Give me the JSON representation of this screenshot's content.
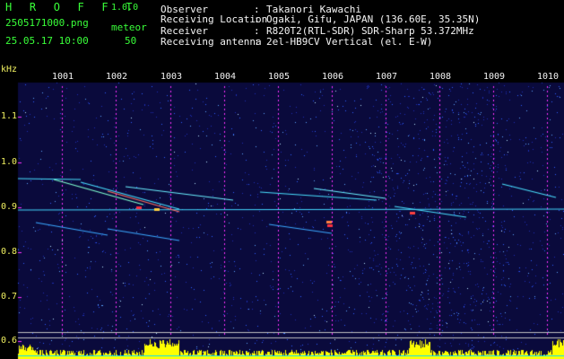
{
  "header": {
    "logo": "H R O F F T",
    "version": "1.0.0",
    "filename": "2505171000.png",
    "meteor_label": "meteor",
    "datetime": "25.05.17 10:00",
    "meteor_count": "50"
  },
  "info": [
    {
      "key": "Observer",
      "sep": ":",
      "value": "Takanori Kawachi"
    },
    {
      "key": "Receiving Location",
      "sep": ":",
      "value": "Ogaki, Gifu, JAPAN (136.60E, 35.35N)"
    },
    {
      "key": "Receiver",
      "sep": ":",
      "value": "R820T2(RTL-SDR) SDR-Sharp 53.372MHz"
    },
    {
      "key": "Receiving antenna",
      "sep": ":",
      "value": "2el-HB9CV Vertical (el. E-W)"
    }
  ],
  "axis": {
    "y_unit": "kHz",
    "y_ticks": [
      "1.1",
      "1.0",
      "0.9",
      "0.8",
      "0.7",
      "0.6"
    ],
    "x_ticks": [
      "1001",
      "1002",
      "1003",
      "1004",
      "1005",
      "1006",
      "1007",
      "1008",
      "1009",
      "1010"
    ]
  },
  "colors": {
    "background": "#0a0a3c",
    "header_green": "#39ff39",
    "header_white": "#f4f4f4",
    "axis_yellow": "#f0f060",
    "tick_magenta": "#ff30ff",
    "strength_bar": "#ffff00",
    "baseline_cyan": "#00e0ff"
  }
}
